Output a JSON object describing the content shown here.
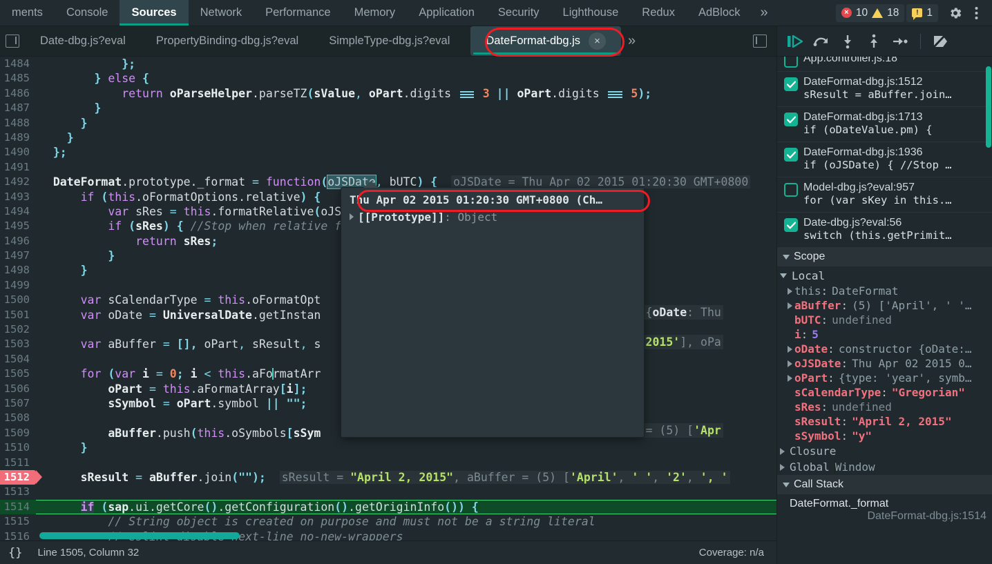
{
  "panel_tabs": [
    {
      "label": "ments",
      "active": false
    },
    {
      "label": "Console",
      "active": false
    },
    {
      "label": "Sources",
      "active": true
    },
    {
      "label": "Network",
      "active": false
    },
    {
      "label": "Performance",
      "active": false
    },
    {
      "label": "Memory",
      "active": false
    },
    {
      "label": "Application",
      "active": false
    },
    {
      "label": "Security",
      "active": false
    },
    {
      "label": "Lighthouse",
      "active": false
    },
    {
      "label": "Redux",
      "active": false
    },
    {
      "label": "AdBlock",
      "active": false
    }
  ],
  "panel_overflow_label": "»",
  "counters": {
    "errors": "10",
    "warnings": "18",
    "info": "1",
    "error_glyph": "×",
    "info_glyph": "!"
  },
  "settings_icon": "gear-icon",
  "more_icon": "kebab-menu-icon",
  "file_tabs": [
    {
      "label": "Date-dbg.js?eval",
      "active": false
    },
    {
      "label": "PropertyBinding-dbg.js?eval",
      "active": false
    },
    {
      "label": "SimpleType-dbg.js?eval",
      "active": false
    },
    {
      "label": "DateFormat-dbg.js",
      "active": true
    }
  ],
  "file_tab_close_glyph": "×",
  "file_overflow_label": "»",
  "editor": {
    "first_line": 1484,
    "lines": [
      {
        "n": 1484
      },
      {
        "n": 1485
      },
      {
        "n": 1486
      },
      {
        "n": 1487
      },
      {
        "n": 1488
      },
      {
        "n": 1489
      },
      {
        "n": 1490
      },
      {
        "n": 1491
      },
      {
        "n": 1492
      },
      {
        "n": 1493
      },
      {
        "n": 1494
      },
      {
        "n": 1495
      },
      {
        "n": 1496
      },
      {
        "n": 1497
      },
      {
        "n": 1498
      },
      {
        "n": 1499
      },
      {
        "n": 1500
      },
      {
        "n": 1501
      },
      {
        "n": 1502
      },
      {
        "n": 1503
      },
      {
        "n": 1504
      },
      {
        "n": 1505
      },
      {
        "n": 1506
      },
      {
        "n": 1507
      },
      {
        "n": 1508
      },
      {
        "n": 1509
      },
      {
        "n": 1510
      },
      {
        "n": 1511
      },
      {
        "n": 1512
      },
      {
        "n": 1513
      },
      {
        "n": 1514
      },
      {
        "n": 1515
      },
      {
        "n": 1516
      }
    ],
    "breakpoint_line": 1512,
    "execution_line": 1514,
    "source_text": {
      "l1484": "            };",
      "l1485": "        } else {",
      "l1486": "            return oParseHelper.parseTZ(sValue, oPart.digits === 3 || oPart.digits === 5);",
      "l1487": "        }",
      "l1488": "      }",
      "l1489": "    }",
      "l1490": "  };",
      "l1491": "",
      "l1492": "  DateFormat.prototype._format = function(oJSDate, bUTC) {",
      "l1493": "      if (this.oFormatOptions.relative) {",
      "l1494": "          var sRes = this.formatRelative(oJSDate, bUTC, aRange);",
      "l1495": "          if (sRes) { //Stop when relative formatting possible, else standard formatting",
      "l1496": "              return sRes;",
      "l1497": "          }",
      "l1498": "      }",
      "l1499": "",
      "l1500": "      var sCalendarType = this.oFormatOptions.calendarType;",
      "l1501": "      var oDate = UniversalDate.getInstance(oJSDate, sCalendarType);",
      "l1502": "",
      "l1503": "      var aBuffer = [], oPart, sResult, sSymbol;",
      "l1504": "",
      "l1505": "      for (var i = 0; i < this.aFormatArray.length; i++) {",
      "l1506": "          oPart = this.aFormatArray[i];",
      "l1507": "          sSymbol = oPart.symbol || \"\";",
      "l1508": "",
      "l1509": "          aBuffer.push(this.oSymbols[sSymbol].format(oPart, oDate, bUTC, this));",
      "l1510": "      }",
      "l1511": "",
      "l1512": "      sResult = aBuffer.join(\"\");",
      "l1513": "",
      "l1514": "      if (sap.ui.getCore().getConfiguration().getOriginInfo()) {",
      "l1515": "          // String object is created on purpose and must not be a string literal",
      "l1516": "          // eslint-disable-next-line no-new-wrappers"
    },
    "inline_values": {
      "l1492": "oJSDate = Thu Apr 02 2015 01:20:30 GMT+0800",
      "l1494_sres": "sRes = u",
      "l1500": "rian\"",
      "l1501": "ructor {oDate: Thu",
      "l1503": "', ', '2015'], oPa",
      "l1506": ": 1}",
      "l1509": "Buffer = (5) ['Apr",
      "l1512": "sResult = \"April 2, 2015\", aBuffer = (5) ['April', ' ', '2', ', '"
    },
    "selected_token": "oJSDate",
    "popover": {
      "value": "Thu Apr 02 2015 01:20:30 GMT+0800 (Ch…",
      "prototype_key": "[[Prototype]]",
      "prototype_value": "Object"
    }
  },
  "statusbar": {
    "format_icon": "{}",
    "cursor": "Line 1505, Column 32",
    "coverage": "Coverage: n/a"
  },
  "debugger_toolbar": [
    {
      "name": "resume-button",
      "glyph": "resume"
    },
    {
      "name": "step-over-button",
      "glyph": "step-over"
    },
    {
      "name": "step-into-button",
      "glyph": "step-into"
    },
    {
      "name": "step-out-button",
      "glyph": "step-out"
    },
    {
      "name": "step-button",
      "glyph": "step"
    },
    {
      "name": "deactivate-breakpoints-button",
      "glyph": "deactivate"
    }
  ],
  "breakpoints": [
    {
      "file": "App.controller.js:18",
      "code": "",
      "checked": false,
      "clipped": true
    },
    {
      "file": "DateFormat-dbg.js:1512",
      "code": "sResult = aBuffer.join…",
      "checked": true
    },
    {
      "file": "DateFormat-dbg.js:1713",
      "code": "if (oDateValue.pm) {",
      "checked": true
    },
    {
      "file": "DateFormat-dbg.js:1936",
      "code": "if (oJSDate) { //Stop …",
      "checked": true
    },
    {
      "file": "Model-dbg.js?eval:957",
      "code": "for (var sKey in this.…",
      "checked": false
    },
    {
      "file": "Date-dbg.js?eval:56",
      "code": "switch (this.getPrimit…",
      "checked": true
    }
  ],
  "scope": {
    "title": "Scope",
    "local_title": "Local",
    "vars": [
      {
        "name": "this",
        "value": "DateFormat",
        "expandable": true,
        "kind": "dim"
      },
      {
        "name": "aBuffer",
        "value": "(5) ['April', ' '…",
        "expandable": true,
        "kind": "plain"
      },
      {
        "name": "bUTC",
        "value": "undefined",
        "expandable": false,
        "kind": "undef"
      },
      {
        "name": "i",
        "value": "5",
        "expandable": false,
        "kind": "num"
      },
      {
        "name": "oDate",
        "value": "constructor {oDate:…",
        "expandable": true,
        "kind": "plain"
      },
      {
        "name": "oJSDate",
        "value": "Thu Apr 02 2015 0…",
        "expandable": true,
        "kind": "plain"
      },
      {
        "name": "oPart",
        "value": "{type: 'year', symb…",
        "expandable": true,
        "kind": "plain"
      },
      {
        "name": "sCalendarType",
        "value": "\"Gregorian\"",
        "expandable": false,
        "kind": "str"
      },
      {
        "name": "sRes",
        "value": "undefined",
        "expandable": false,
        "kind": "undef"
      },
      {
        "name": "sResult",
        "value": "\"April 2, 2015\"",
        "expandable": false,
        "kind": "str"
      },
      {
        "name": "sSymbol",
        "value": "\"y\"",
        "expandable": false,
        "kind": "str"
      }
    ],
    "closure_label": "Closure",
    "global_label": "Global",
    "global_value": "Window"
  },
  "call_stack": {
    "title": "Call Stack",
    "frames": [
      {
        "fn": "DateFormat._format",
        "loc": "DateFormat-dbg.js:1514"
      }
    ]
  }
}
